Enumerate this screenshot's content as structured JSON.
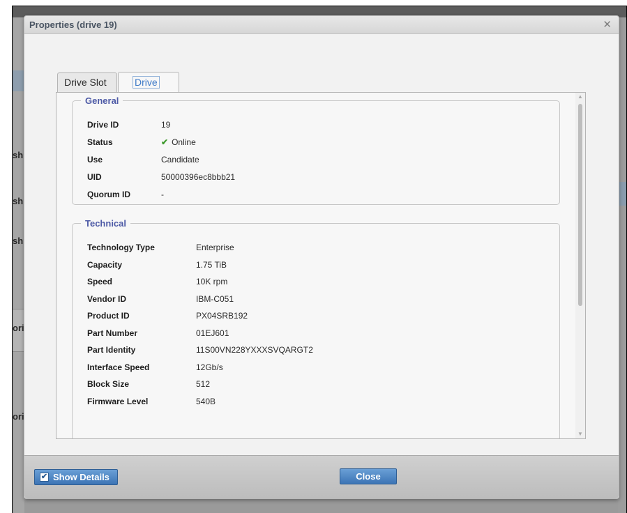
{
  "background": {
    "fragments": [
      "sh",
      "sh",
      "sh",
      "ori",
      "oris"
    ]
  },
  "dialog": {
    "title": "Properties (drive 19)",
    "close_icon": "close-x-icon"
  },
  "tabs": [
    {
      "label": "Drive Slot",
      "active": false
    },
    {
      "label": "Drive",
      "active": true
    }
  ],
  "general": {
    "title": "General",
    "rows": [
      {
        "label": "Drive ID",
        "value": "19"
      },
      {
        "label": "Status",
        "value": "Online",
        "icon": "check-icon",
        "icon_color": "#3f9a2d"
      },
      {
        "label": "Use",
        "value": "Candidate"
      },
      {
        "label": "UID",
        "value": "50000396ec8bbb21"
      },
      {
        "label": "Quorum ID",
        "value": "-"
      }
    ]
  },
  "technical": {
    "title": "Technical",
    "rows": [
      {
        "label": "Technology Type",
        "value": "Enterprise"
      },
      {
        "label": "Capacity",
        "value": "1.75 TiB"
      },
      {
        "label": "Speed",
        "value": "10K rpm"
      },
      {
        "label": "Vendor ID",
        "value": "IBM-C051"
      },
      {
        "label": "Product ID",
        "value": "PX04SRB192"
      },
      {
        "label": "Part Number",
        "value": "01EJ601"
      },
      {
        "label": "Part Identity",
        "value": "11S00VN228YXXXSVQARGT2"
      },
      {
        "label": "Interface Speed",
        "value": "12Gb/s"
      },
      {
        "label": "Block Size",
        "value": "512"
      },
      {
        "label": "Firmware Level",
        "value": "540B"
      }
    ]
  },
  "footer": {
    "show_details_label": "Show Details",
    "show_details_checked": true,
    "close_label": "Close"
  },
  "colors": {
    "accent": "#3d7ac7",
    "group_title": "#4d5aa6",
    "button": "#4a82c0"
  }
}
